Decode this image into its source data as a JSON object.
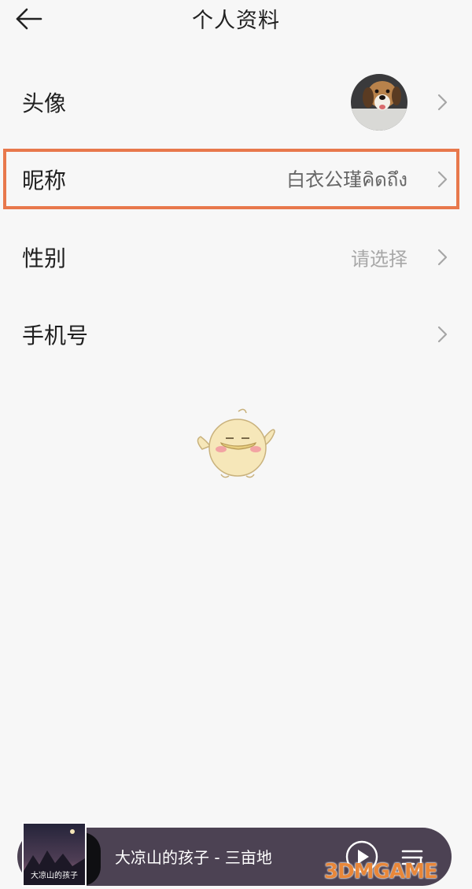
{
  "header": {
    "back_icon": "arrow-left-icon",
    "title": "个人资料"
  },
  "rows": [
    {
      "label": "头像",
      "value": "",
      "icon": "avatar-photo"
    },
    {
      "label": "昵称",
      "value": "白衣公瑾คิดถึง"
    },
    {
      "label": "性别",
      "value": "请选择",
      "is_placeholder": true
    },
    {
      "label": "手机号",
      "value": ""
    }
  ],
  "highlight_color": "#e8784c",
  "player": {
    "song": "大凉山的孩子 - 三亩地",
    "album_title": "大凉山的孩子",
    "play_icon": "play-icon",
    "playlist_icon": "playlist-icon",
    "background": "#4c4253"
  },
  "watermark": "3DMGAME"
}
